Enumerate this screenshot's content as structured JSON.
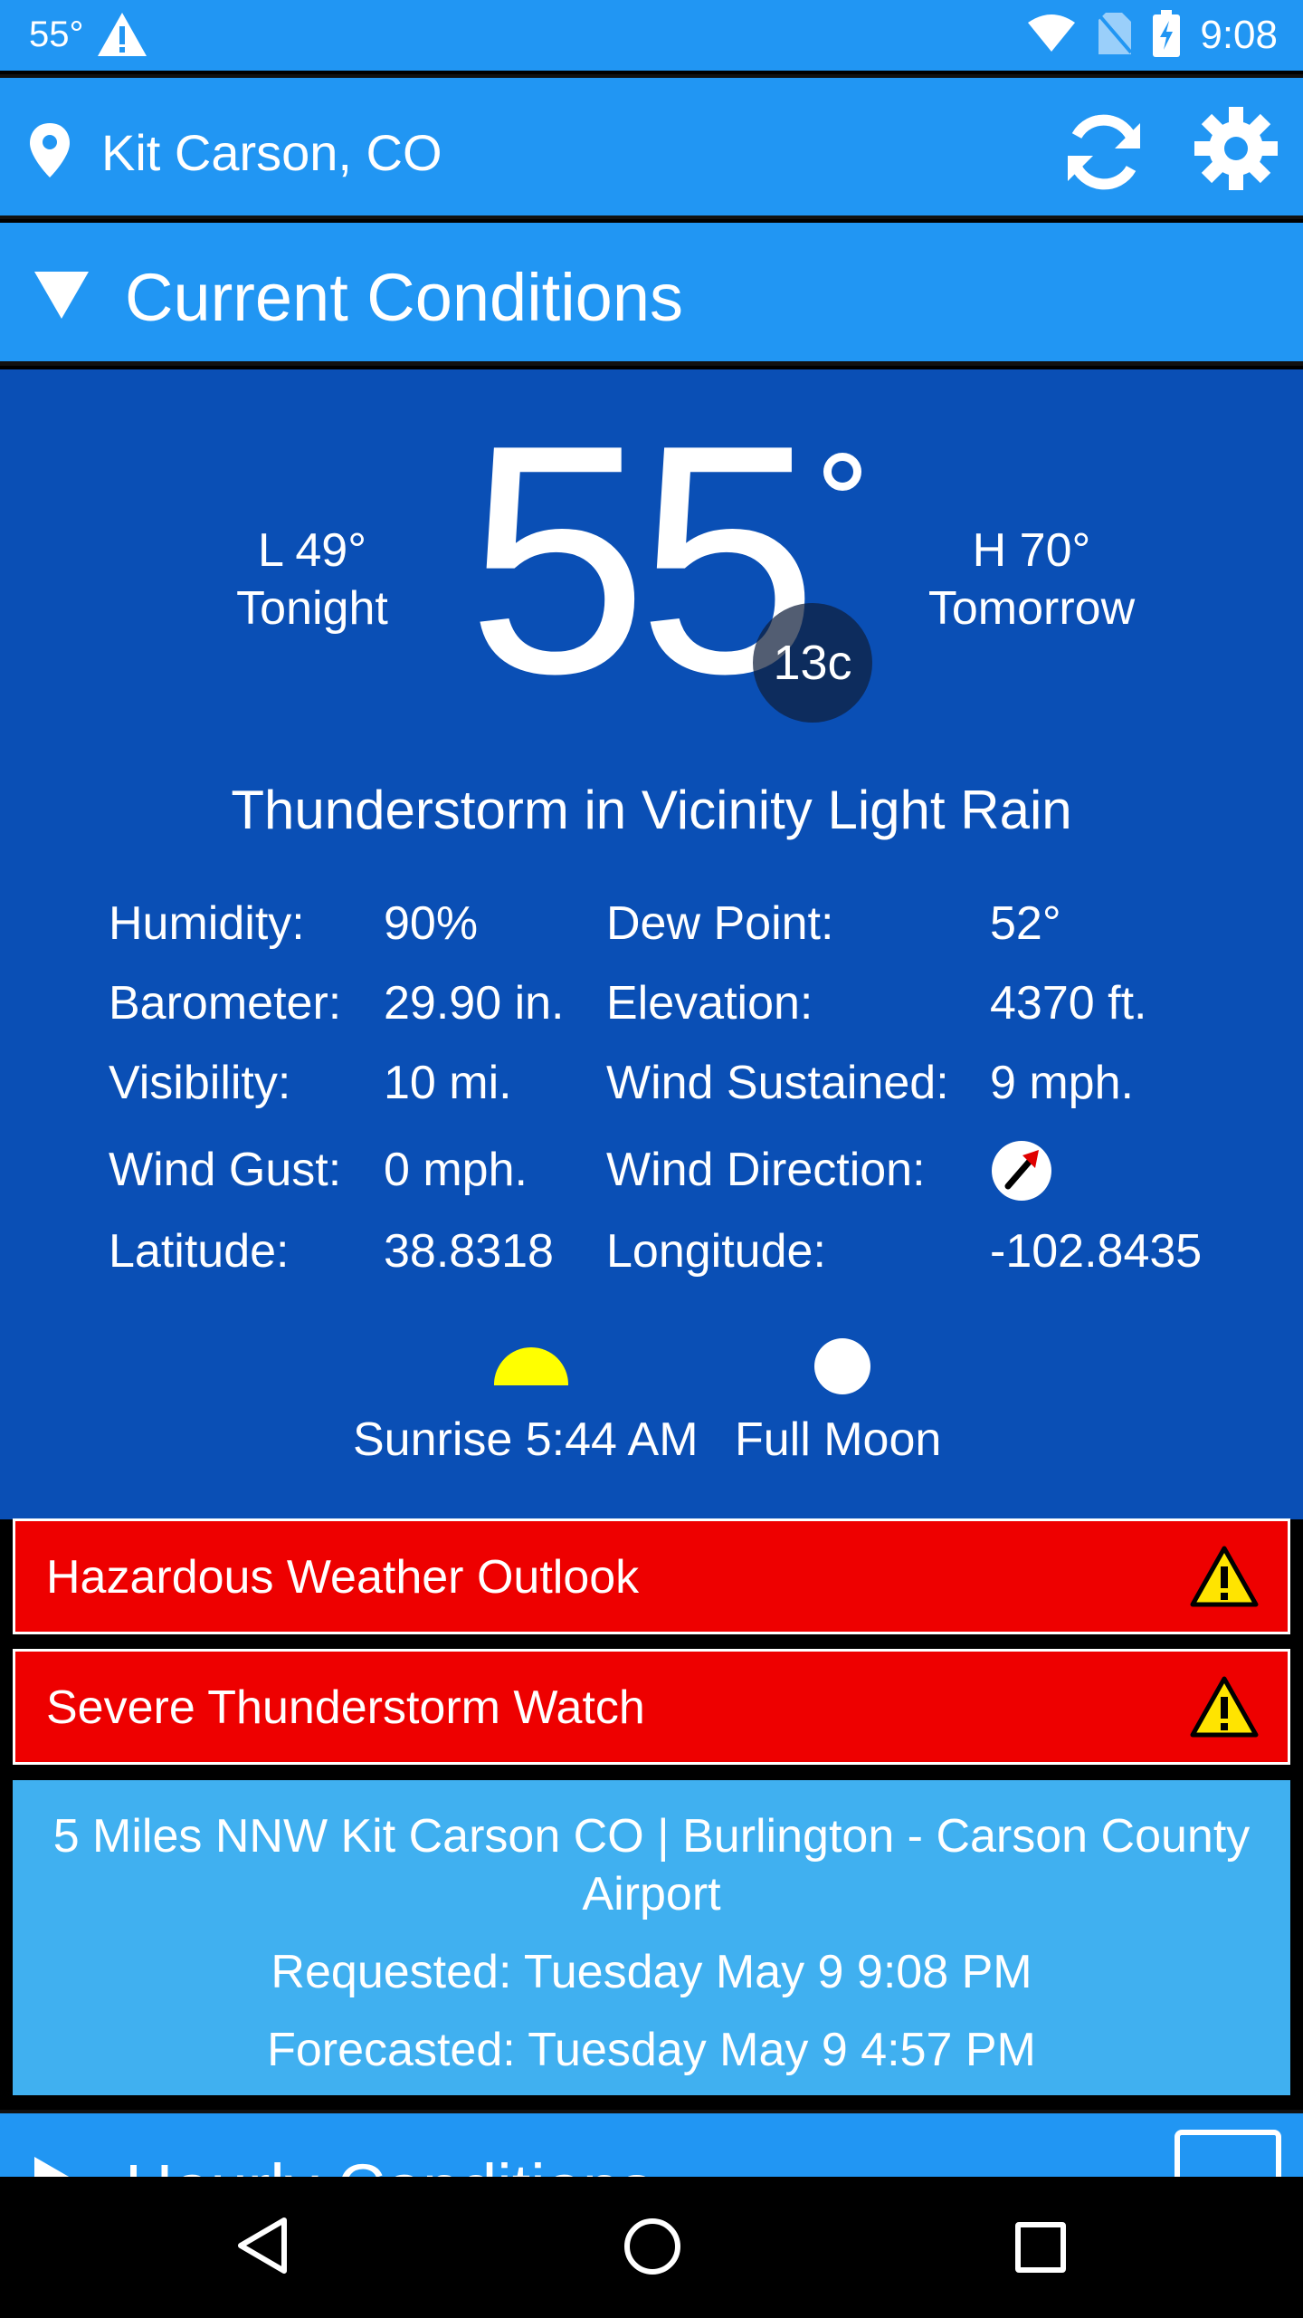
{
  "status_bar": {
    "temp": "55°",
    "time": "9:08"
  },
  "location": {
    "name": "Kit Carson, CO"
  },
  "section": {
    "title": "Current Conditions"
  },
  "current": {
    "temp": "55",
    "temp_c": "13c",
    "low_line1": "L 49°",
    "low_line2": "Tonight",
    "high_line1": "H 70°",
    "high_line2": "Tomorrow",
    "description": "Thunderstorm in Vicinity Light Rain"
  },
  "details": [
    {
      "label": "Humidity:",
      "value": "90%",
      "label2": "Dew Point:",
      "value2": "52°"
    },
    {
      "label": "Barometer:",
      "value": "29.90 in.",
      "label2": "Elevation:",
      "value2": "4370 ft."
    },
    {
      "label": "Visibility:",
      "value": "10 mi.",
      "label2": "Wind Sustained:",
      "value2": "9 mph."
    },
    {
      "label": "Wind Gust:",
      "value": "0 mph.",
      "label2": "Wind Direction:",
      "value2": ""
    },
    {
      "label": "Latitude:",
      "value": "38.8318",
      "label2": "Longitude:",
      "value2": "-102.8435"
    }
  ],
  "astro": {
    "sunrise": "Sunrise 5:44 AM",
    "moon": "Full Moon",
    "sun_color": "#ffff00"
  },
  "alerts": [
    {
      "label": "Hazardous Weather Outlook"
    },
    {
      "label": "Severe Thunderstorm Watch"
    }
  ],
  "station": {
    "name": "5 Miles NNW Kit Carson CO | Burlington - Carson County Airport",
    "requested": "Requested: Tuesday May 9 9:08 PM",
    "forecasted": "Forecasted: Tuesday May 9 4:57 PM"
  },
  "hourly": {
    "title": "Hourly Conditions"
  },
  "colors": {
    "header_blue": "#2196f3",
    "panel_blue": "#0a4fb5",
    "alert_red": "#ee0000",
    "info_blue": "#40b0f0"
  },
  "icons": [
    "location-pin-icon",
    "refresh-icon",
    "gear-icon",
    "collapse-triangle-icon",
    "wind-direction-icon",
    "sunrise-icon",
    "full-moon-icon",
    "warning-icon",
    "image-icon"
  ]
}
